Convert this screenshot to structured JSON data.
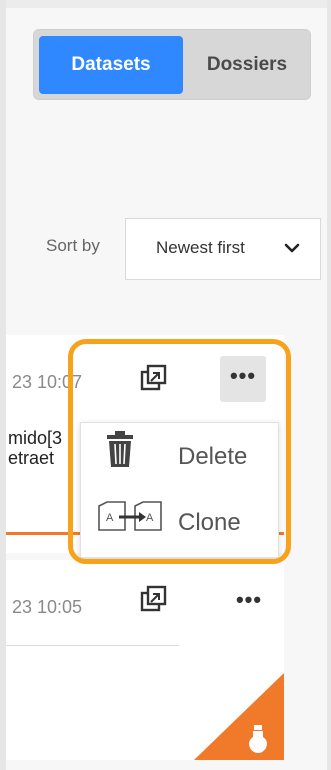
{
  "toggle": {
    "datasets_label": "Datasets",
    "dossiers_label": "Dossiers",
    "active": "Datasets"
  },
  "sort": {
    "label": "Sort by",
    "value": "Newest first",
    "icon": "chevron-down-icon"
  },
  "cards": [
    {
      "time": "23 10:07",
      "title_line1": "mido[3",
      "title_line2": "etraet",
      "open_icon": "open-external-icon",
      "more_icon": "more-dots-icon",
      "more_label": "•••"
    },
    {
      "time": "23 10:05",
      "open_icon": "open-external-icon",
      "more_icon": "more-dots-icon",
      "more_label": "•••",
      "corner_icon": "flask-icon"
    }
  ],
  "menu": {
    "items": [
      {
        "label": "Delete",
        "icon": "trash-icon"
      },
      {
        "label": "Clone",
        "icon": "clone-icon",
        "icon_text_left": "A",
        "icon_text_right": "A"
      }
    ]
  },
  "colors": {
    "accent": "#2f88ff",
    "highlight": "#f7a21b",
    "card_orange": "#f07a2a"
  }
}
